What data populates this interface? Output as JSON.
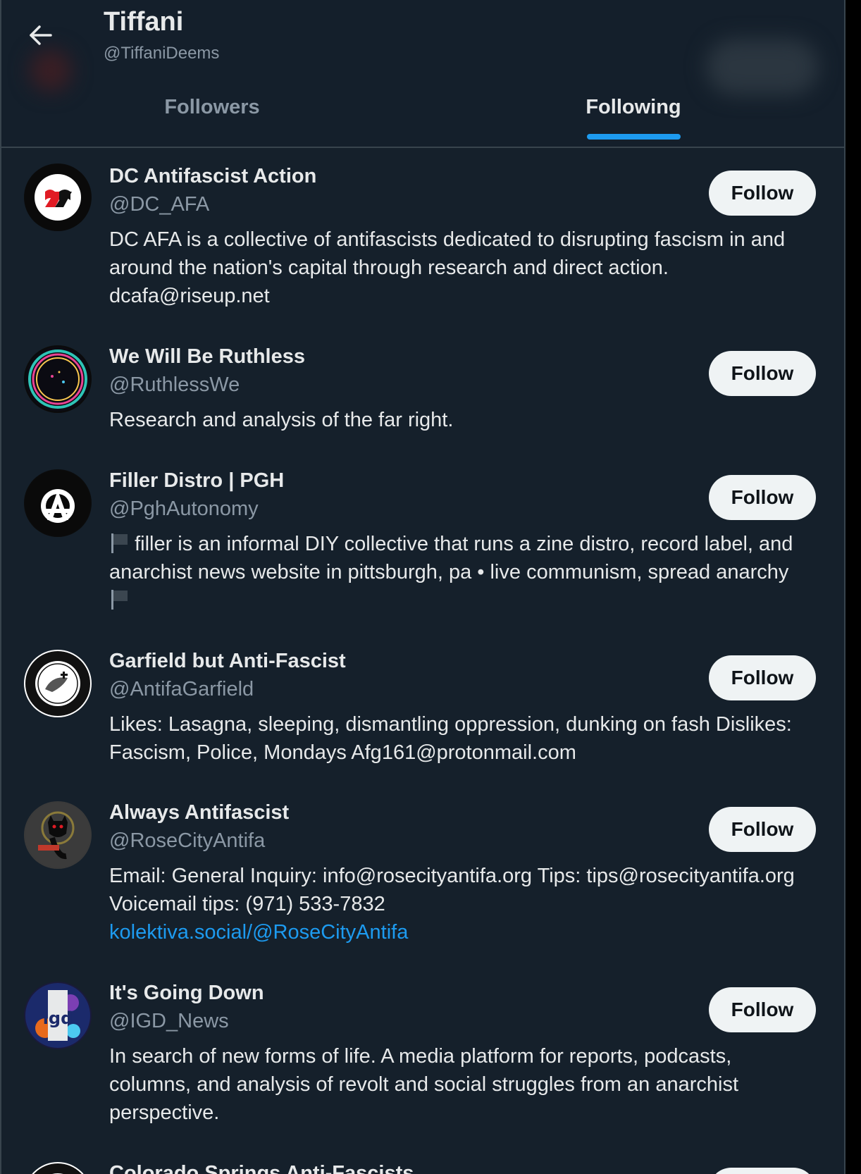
{
  "header": {
    "title": "Tiffani",
    "handle": "@TiffaniDeems",
    "tabs": [
      {
        "label": "Followers",
        "active": false
      },
      {
        "label": "Following",
        "active": true
      }
    ]
  },
  "follow_label": "Follow",
  "users": [
    {
      "name": "DC Antifascist Action",
      "handle": "@DC_AFA",
      "bio": "DC AFA is a collective of antifascists dedicated to disrupting fascism in and around the nation's capital through research and direct action. dcafa@riseup.net"
    },
    {
      "name": "We Will Be Ruthless",
      "handle": "@RuthlessWe",
      "bio": "Research and analysis of the far right."
    },
    {
      "name": "Filler Distro | PGH",
      "handle": "@PghAutonomy",
      "bio": "filler is an informal DIY collective that runs a zine distro, record label, and anarchist news website in pittsburgh, pa • live communism, spread anarchy"
    },
    {
      "name": "Garfield but Anti-Fascist",
      "handle": "@AntifaGarfield",
      "bio": "Likes: Lasagna, sleeping, dismantling oppression, dunking on fash Dislikes: Fascism, Police, Mondays Afg161@protonmail.com"
    },
    {
      "name": "Always Antifascist",
      "handle": "@RoseCityAntifa",
      "bio": "Email: General Inquiry: info@rosecityantifa.org Tips: tips@rosecityantifa.org Voicemail tips: (971) 533-7832",
      "link": "kolektiva.social/@RoseCityAntifa"
    },
    {
      "name": "It's Going Down",
      "handle": "@IGD_News",
      "bio": "In search of new forms of life. A media platform for reports, podcasts, columns, and analysis of revolt and social struggles from an anarchist perspective."
    },
    {
      "name": "Colorado Springs Anti-Fascists",
      "handle": "",
      "bio": ""
    }
  ],
  "colors": {
    "background": "#15202b",
    "accent": "#1d9bf0",
    "secondary_text": "#8b98a5",
    "button_bg": "#eff3f4"
  }
}
